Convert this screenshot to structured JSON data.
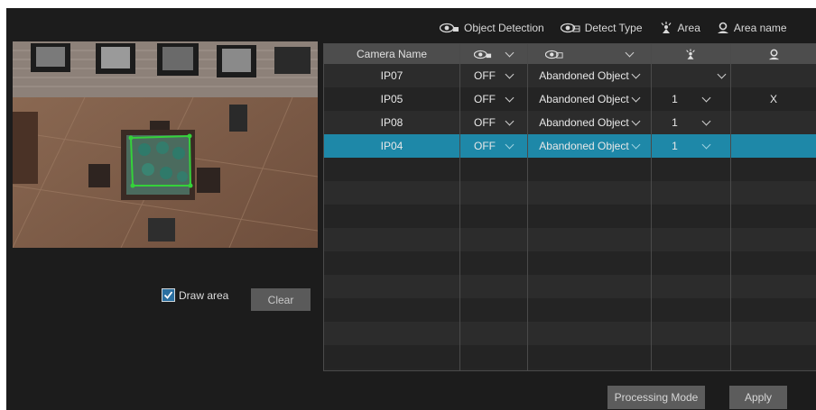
{
  "legend": [
    {
      "icon": "eye-object-icon",
      "label": "Object Detection"
    },
    {
      "icon": "eye-type-icon",
      "label": "Detect Type"
    },
    {
      "icon": "area-icon",
      "label": "Area"
    },
    {
      "icon": "user-icon",
      "label": "Area name"
    }
  ],
  "table": {
    "headers": {
      "camera": "Camera Name"
    },
    "rows": [
      {
        "camera": "IP07",
        "detection": "OFF",
        "type": "Abandoned Object",
        "area": "",
        "area_name": ""
      },
      {
        "camera": "IP05",
        "detection": "OFF",
        "type": "Abandoned Object",
        "area": "1",
        "area_name": "X"
      },
      {
        "camera": "IP08",
        "detection": "OFF",
        "type": "Abandoned Object",
        "area": "1",
        "area_name": ""
      },
      {
        "camera": "IP04",
        "detection": "OFF",
        "type": "Abandoned Object",
        "area": "1",
        "area_name": ""
      }
    ],
    "selected_row": 3
  },
  "draw_area": {
    "label": "Draw area",
    "checked": true
  },
  "buttons": {
    "clear": "Clear",
    "processing_mode": "Processing Mode",
    "apply": "Apply"
  },
  "colors": {
    "selected_row": "#1e88a8",
    "background": "#1c1c1c",
    "header": "#4d4d4d",
    "button": "#5c5c5c"
  }
}
